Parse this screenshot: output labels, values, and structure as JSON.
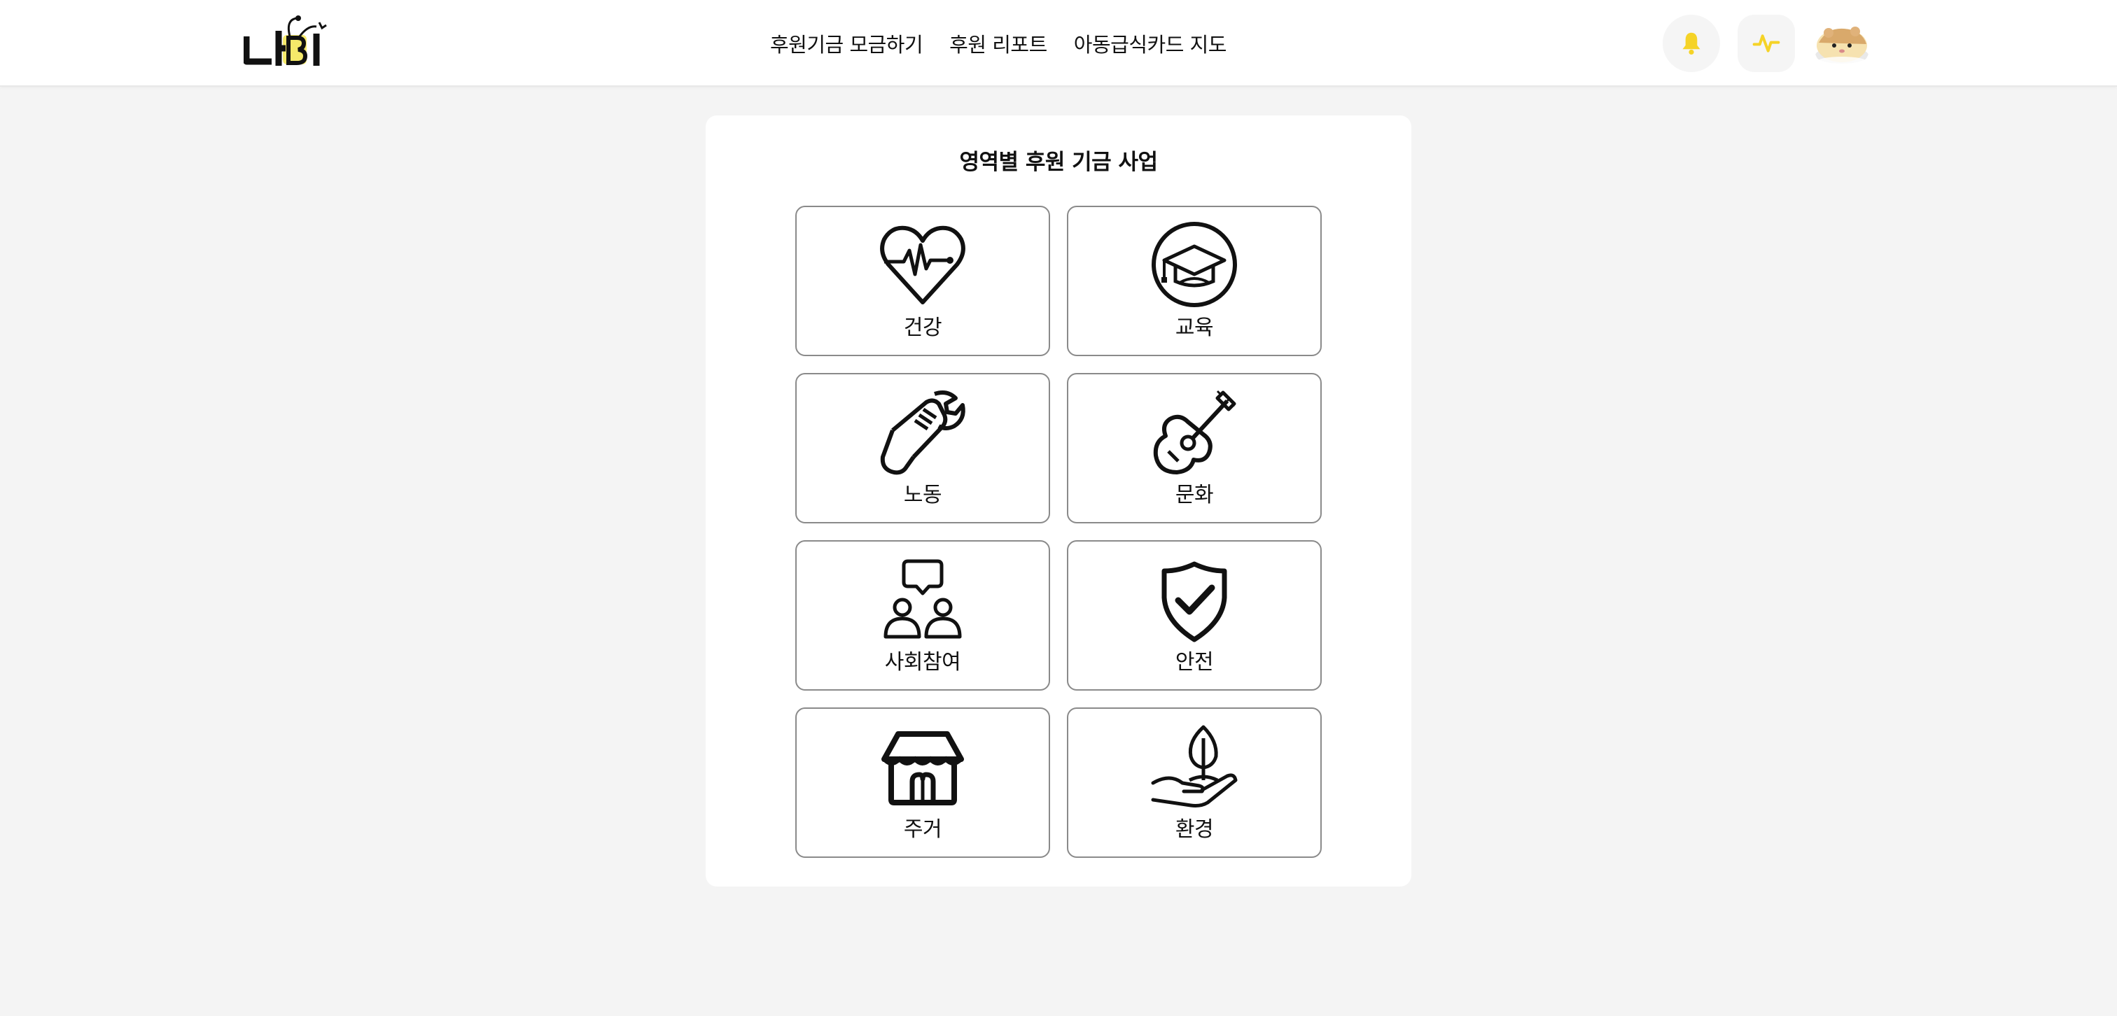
{
  "header": {
    "logo_text": "나비",
    "nav": [
      {
        "label": "후원기금 모금하기"
      },
      {
        "label": "후원 리포트"
      },
      {
        "label": "아동급식카드 지도"
      }
    ],
    "notification_icon": "bell-icon",
    "activity_icon": "pulse-icon",
    "avatar_icon": "hamster-avatar",
    "accent_color": "#f5d327"
  },
  "main": {
    "title": "영역별 후원 기금 사업",
    "categories": [
      {
        "label": "건강",
        "icon": "heart-pulse-icon"
      },
      {
        "label": "교육",
        "icon": "graduation-cap-icon"
      },
      {
        "label": "노동",
        "icon": "wrench-hand-icon"
      },
      {
        "label": "문화",
        "icon": "guitar-icon"
      },
      {
        "label": "사회참여",
        "icon": "people-speech-icon"
      },
      {
        "label": "안전",
        "icon": "shield-check-icon"
      },
      {
        "label": "주거",
        "icon": "house-icon"
      },
      {
        "label": "환경",
        "icon": "hand-sprout-icon"
      }
    ]
  }
}
